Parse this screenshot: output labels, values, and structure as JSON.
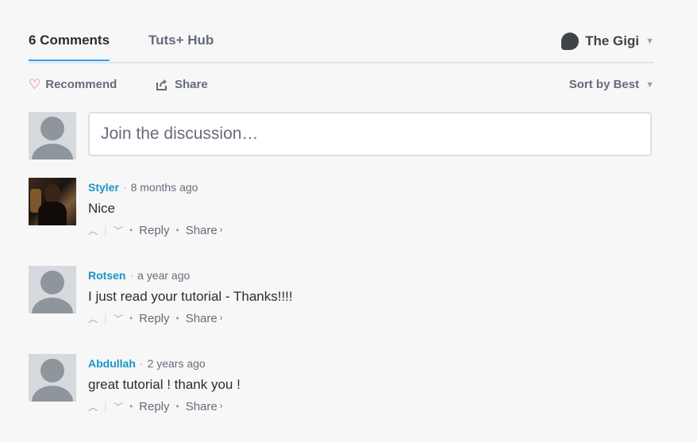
{
  "header": {
    "tabs": [
      {
        "label": "6 Comments",
        "active": true
      },
      {
        "label": "Tuts+ Hub",
        "active": false
      }
    ],
    "user_name": "The Gigi"
  },
  "toolbar": {
    "recommend_label": "Recommend",
    "share_label": "Share",
    "sort_label": "Sort by Best"
  },
  "composer": {
    "placeholder": "Join the discussion…"
  },
  "comments": [
    {
      "author": "Styler",
      "time": "8 months ago",
      "text": "Nice",
      "reply": "Reply",
      "share": "Share"
    },
    {
      "author": "Rotsen",
      "time": "a year ago",
      "text": "I just read your tutorial - Thanks!!!!",
      "reply": "Reply",
      "share": "Share"
    },
    {
      "author": "Abdullah",
      "time": "2 years ago",
      "text": "great tutorial ! thank you !",
      "reply": "Reply",
      "share": "Share"
    }
  ],
  "colors": {
    "accent": "#2e9fff",
    "author": "#1a95c9",
    "heart": "#e0405b"
  }
}
